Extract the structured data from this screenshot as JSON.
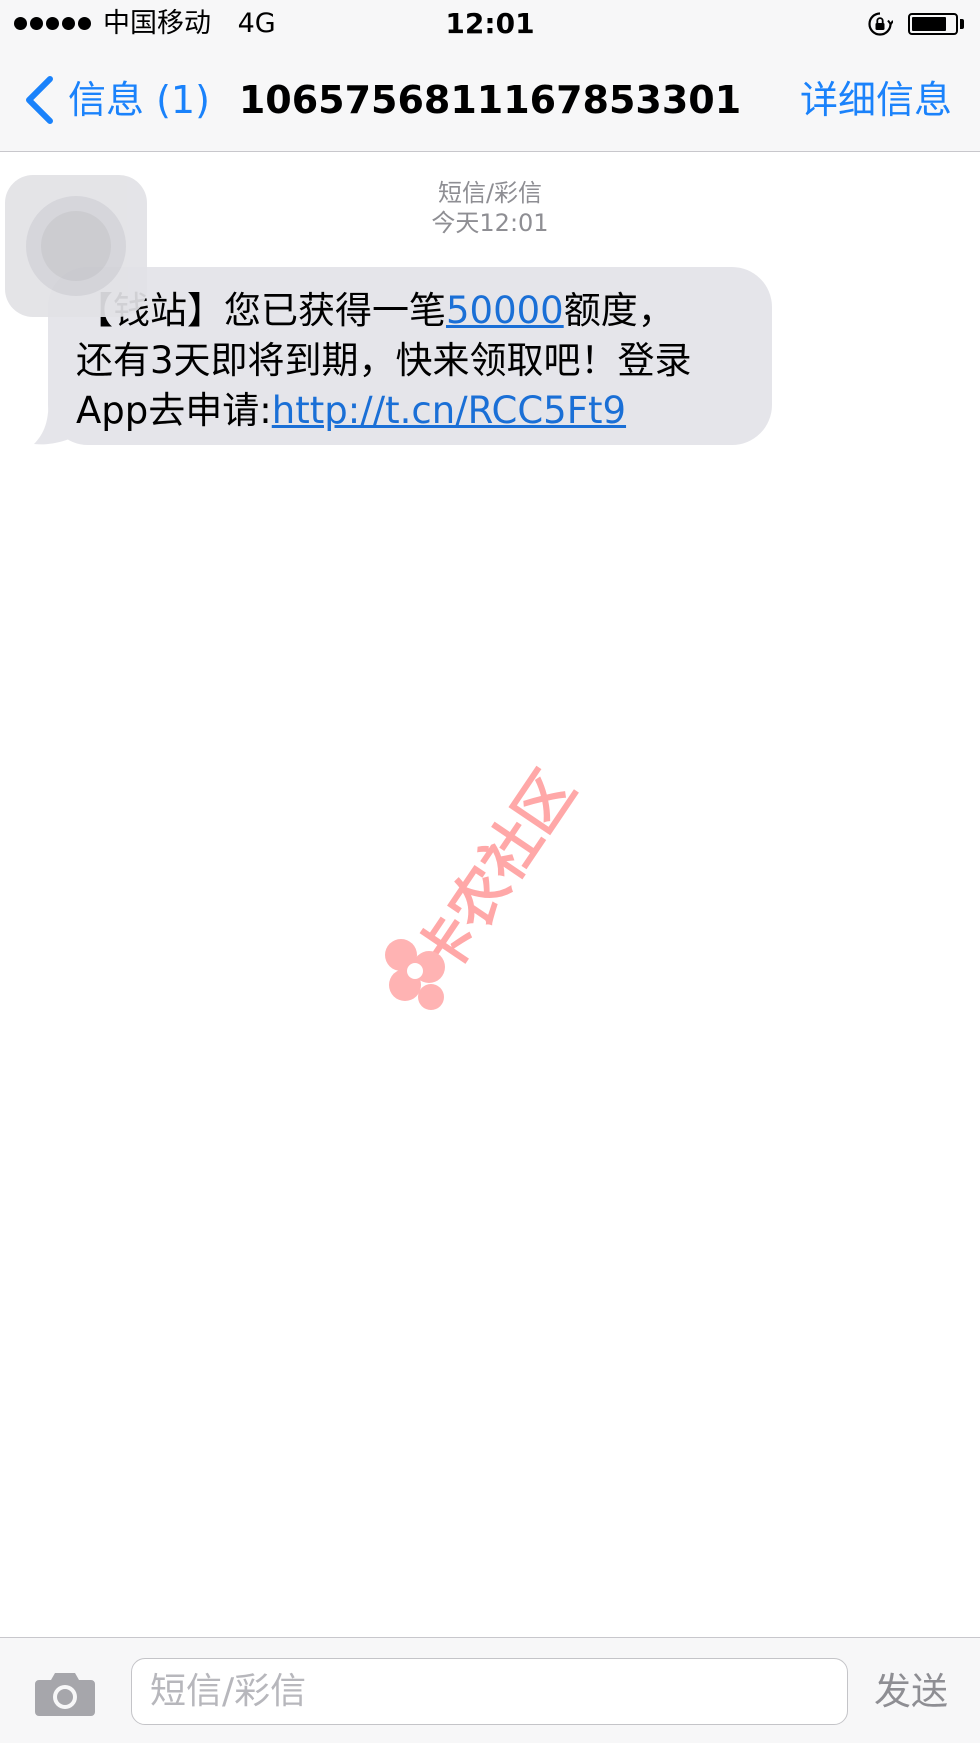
{
  "status_bar": {
    "signal_bars": 5,
    "carrier": "中国移动",
    "network": "4G",
    "time": "12:01",
    "battery_level": 0.8
  },
  "nav": {
    "back_label": "信息 (1)",
    "title": "1065756811167853301",
    "details_label": "详细信息",
    "accent_color": "#1a82fb"
  },
  "conversation": {
    "channel_label": "短信/彩信",
    "timestamp": "今天12:01",
    "messages": [
      {
        "direction": "incoming",
        "line1_prefix": "【钱站】您已获得一笔",
        "line1_amount": "50000",
        "line1_suffix": "额度，",
        "line2": "还有3天即将到期，快来领取吧！登录",
        "line3_prefix": "App去申请:",
        "line3_link": "http://t.cn/RCC5Ft9"
      }
    ]
  },
  "watermark": {
    "text": "卡农社区",
    "color": "#ff8c8c"
  },
  "input_bar": {
    "placeholder": "短信/彩信",
    "value": "",
    "send_label": "发送"
  }
}
